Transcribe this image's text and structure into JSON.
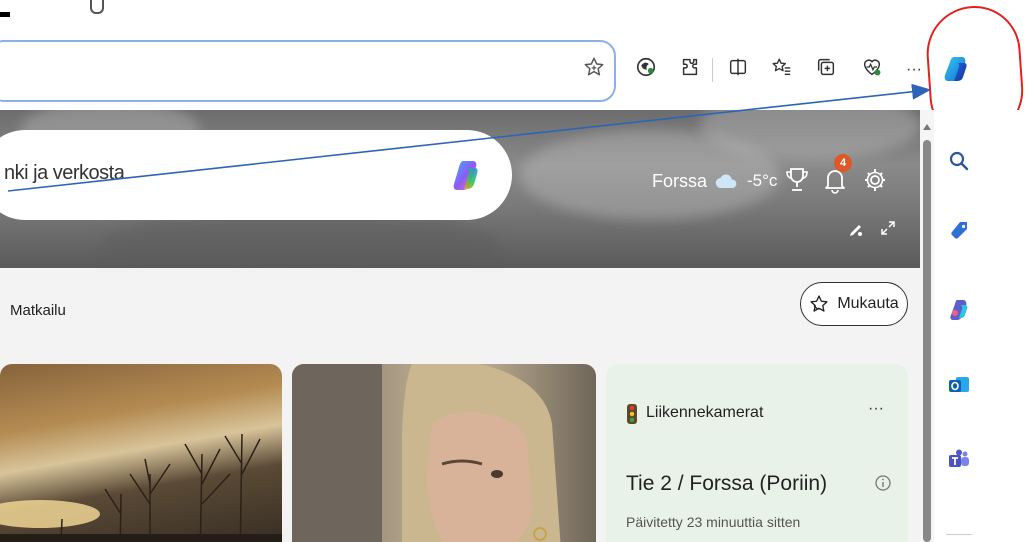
{
  "toolbar": {
    "address_value": "",
    "address_placeholder": "",
    "icons": [
      "favorite-star-icon",
      "browser-essentials-icon",
      "extensions-icon",
      "split-screen-icon",
      "favorites-icon",
      "collections-icon",
      "health-icon",
      "more-icon"
    ]
  },
  "search": {
    "text": "nki ja verkosta"
  },
  "weather": {
    "city": "Forssa",
    "temperature": "-5°c"
  },
  "notifications": {
    "count": "4"
  },
  "nav": {
    "category": "Matkailu"
  },
  "customize": {
    "label": "Mukauta"
  },
  "traffic_card": {
    "title": "Liikennekamerat",
    "more": "···",
    "heading": "Tie 2 / Forssa (Poriin)",
    "updated": "Päivitetty 23 minuuttia sitten"
  },
  "sidebar": {
    "items": [
      "search-icon",
      "tag-icon",
      "m365-icon",
      "outlook-icon",
      "teams-icon"
    ]
  },
  "colors": {
    "annotation_red": "#e0231f",
    "arrow_blue": "#2e64b6",
    "badge_orange": "#e0582a",
    "traffic_card_bg": "#e9f2e9"
  }
}
